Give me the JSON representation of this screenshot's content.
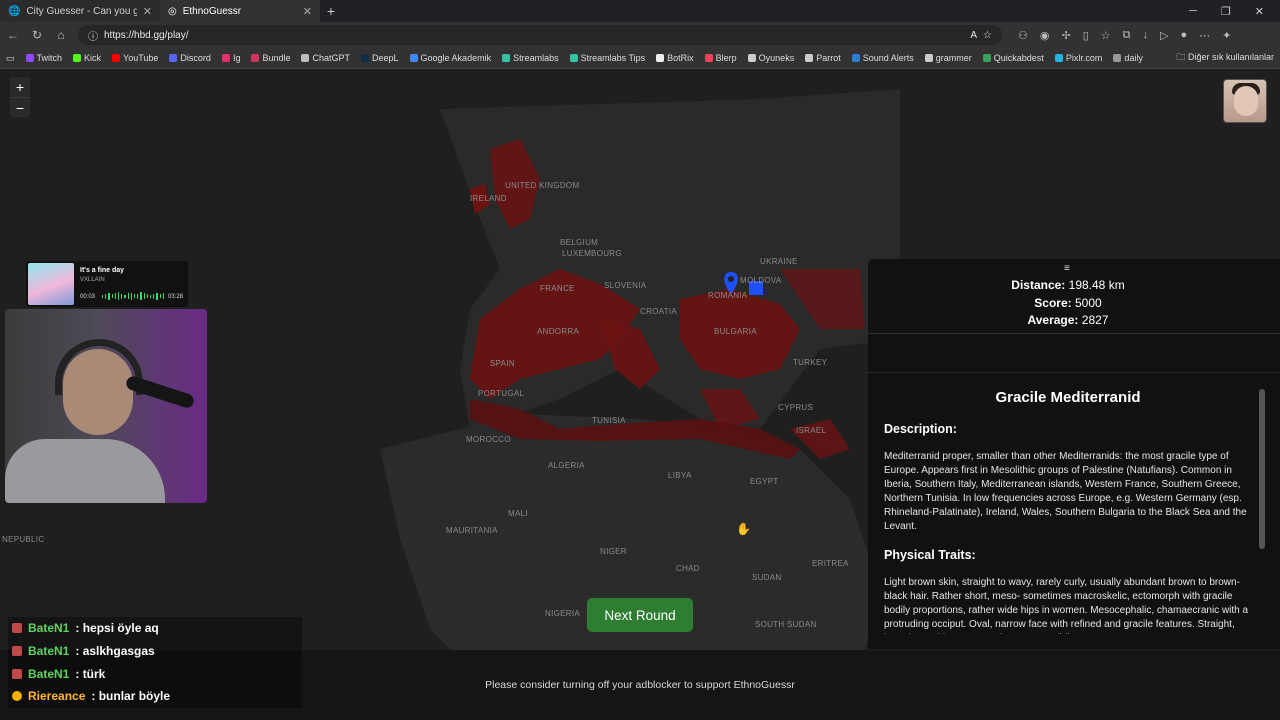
{
  "browser": {
    "tabs": [
      {
        "title": "City Guesser - Can you guess wh…",
        "close": "✕"
      },
      {
        "title": "EthnoGuessr",
        "close": "✕"
      }
    ],
    "new_tab": "+",
    "url": "https://hbd.gg/play/",
    "bookmarks": [
      {
        "label": "Twitch",
        "color": "#9146ff"
      },
      {
        "label": "Kick",
        "color": "#53fc18"
      },
      {
        "label": "YouTube",
        "color": "#ff0000"
      },
      {
        "label": "Discord",
        "color": "#5865f2"
      },
      {
        "label": "Ig",
        "color": "#e1306c"
      },
      {
        "label": "Bundle",
        "color": "#d6335c"
      },
      {
        "label": "ChatGPT",
        "color": "#bbbbbb"
      },
      {
        "label": "DeepL",
        "color": "#0f2b46"
      },
      {
        "label": "Google Akademik",
        "color": "#4285f4"
      },
      {
        "label": "Streamlabs",
        "color": "#31c3a2"
      },
      {
        "label": "Streamlabs Tips",
        "color": "#31c3a2"
      },
      {
        "label": "BotRix",
        "color": "#eeeeee"
      },
      {
        "label": "Blerp",
        "color": "#f5405c"
      },
      {
        "label": "Oyuneks",
        "color": "#cccccc"
      },
      {
        "label": "Parrot",
        "color": "#cccccc"
      },
      {
        "label": "Sound Alerts",
        "color": "#2a7fd4"
      },
      {
        "label": "grammer",
        "color": "#cccccc"
      },
      {
        "label": "Quickabdest",
        "color": "#3aa35a"
      },
      {
        "label": "Pixlr.com",
        "color": "#23b4e6"
      },
      {
        "label": "daily",
        "color": "#999999"
      }
    ],
    "other_bookmarks": "Diğer sık kullanılanlar"
  },
  "map": {
    "zoom_in": "+",
    "zoom_out": "−",
    "labels": [
      "IRELAND",
      "UNITED KINGDOM",
      "BELGIUM",
      "LUXEMBOURG",
      "FRANCE",
      "ANDORRA",
      "SPAIN",
      "PORTUGAL",
      "MOROCCO",
      "ALGERIA",
      "TUNISIA",
      "LIBYA",
      "EGYPT",
      "MAURITANIA",
      "MALI",
      "NIGER",
      "CHAD",
      "SUDAN",
      "ERITREA",
      "SOUTH SUDAN",
      "NIGERIA",
      "SLOVENIA",
      "CROATIA",
      "ROMANIA",
      "MOLDOVA",
      "UKRAINE",
      "BULGARIA",
      "TURKEY",
      "CYPRUS",
      "ISRAEL",
      "NEPUBLIC"
    ]
  },
  "music": {
    "song": "It's a fine day",
    "artist": "VXLLAIN",
    "elapsed": "00:03",
    "total": "03:28"
  },
  "results": {
    "drag_handle": "≡",
    "distance_label": "Distance:",
    "distance_value": "198.48 km",
    "score_label": "Score:",
    "score_value": "5000",
    "average_label": "Average:",
    "average_value": "2827",
    "title": "Gracile Mediterranid",
    "description_heading": "Description:",
    "description": "Mediterranid proper, smaller than other Mediterranids: the most gracile type of Europe. Appears first in Mesolithic groups of Palestine (Natufians). Common in Iberia, Southern Italy, Mediterranean islands, Western France, Southern Greece, Northern Tunisia. In low frequencies across Europe, e.g. Western Germany (esp. Rhineland-Palatinate), Ireland, Wales, Southern Bulgaria to the Black Sea and the Levant.",
    "traits_heading": "Physical Traits:",
    "traits": "Light brown skin, straight to wavy, rarely curly, usually abundant brown to brown-black hair. Rather short, meso- sometimes macroskelic, ectomorph with gracile bodily proportions, rather wide hips in women. Mesocephalic, chamaecranic with a protruding occiput. Oval, narrow face with refined and gracile features. Straight, hyperleptorrhine, not very long nose. Mildly"
  },
  "next_round": "Next Round",
  "chat": [
    {
      "user": "BateN1",
      "message": ": hepsi öyle aq"
    },
    {
      "user": "BateN1",
      "message": ": aslkhgasgas"
    },
    {
      "user": "BateN1",
      "message": ": türk"
    },
    {
      "user": "Riereance",
      "message": ": bunlar böyle"
    }
  ],
  "adblock_notice": "Please consider turning off your adblocker to support EthnoGuessr"
}
